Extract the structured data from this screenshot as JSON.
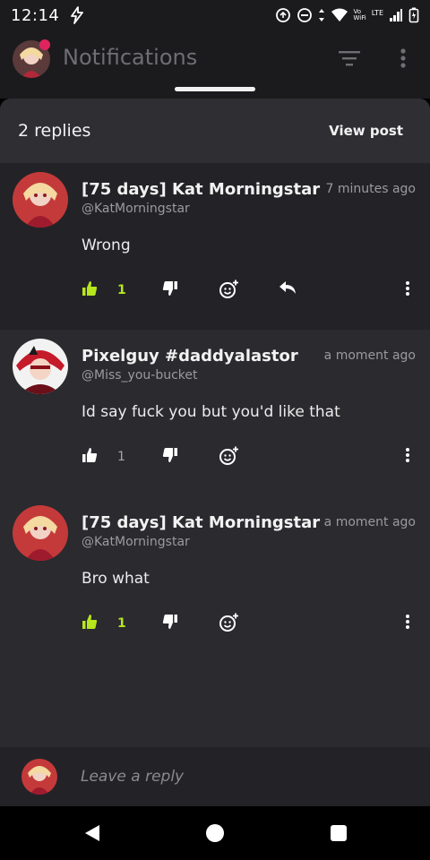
{
  "status_bar": {
    "time": "12:14",
    "network_label_top": "Vo",
    "network_label_bottom": "WiFi",
    "lte_label": "LTE"
  },
  "app_bar": {
    "title": "Notifications"
  },
  "sheet": {
    "title": "2 replies",
    "view_post_label": "View post"
  },
  "comments": [
    {
      "name": "[75 days] Kat Morningstar",
      "handle": "@KatMorningstar",
      "time": "7 minutes ago",
      "text": "Wrong",
      "likes": "1",
      "liked": true
    },
    {
      "name": "Pixelguy #daddyalastor",
      "handle": "@Miss_you-bucket",
      "time": "a moment ago",
      "text": "Id say fuck you but you'd like that",
      "likes": "1",
      "liked": false
    },
    {
      "name": "[75 days] Kat Morningstar",
      "handle": "@KatMorningstar",
      "time": "a moment ago",
      "text": "Bro what",
      "likes": "1",
      "liked": true
    }
  ],
  "reply_bar": {
    "placeholder": "Leave a reply"
  },
  "colors": {
    "accent_like": "#b6e61c",
    "badge": "#e0245e",
    "sheet_bg": "#2a2a2f"
  }
}
